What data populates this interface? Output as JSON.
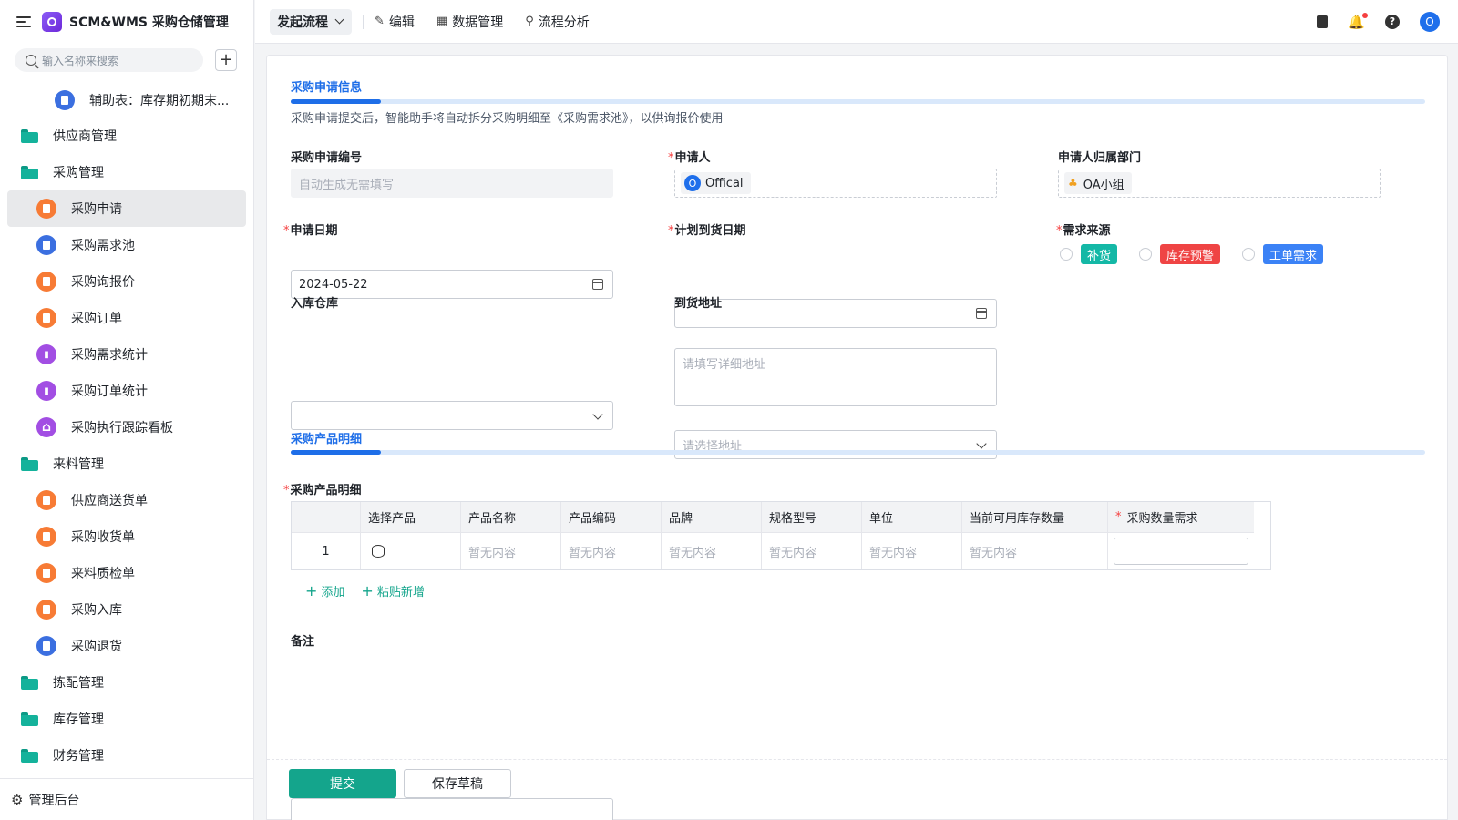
{
  "app": {
    "title": "SCM&WMS 采购仓储管理"
  },
  "search": {
    "placeholder": "输入名称来搜索"
  },
  "sidebar": {
    "pinned": {
      "label": "辅助表：库存期初期末..."
    },
    "items": [
      {
        "label": "供应商管理",
        "type": "folder"
      },
      {
        "label": "采购管理",
        "type": "folder"
      },
      {
        "label": "采购申请",
        "icon": "orange"
      },
      {
        "label": "采购需求池",
        "icon": "blue"
      },
      {
        "label": "采购询报价",
        "icon": "orange"
      },
      {
        "label": "采购订单",
        "icon": "orange"
      },
      {
        "label": "采购需求统计",
        "icon": "purple"
      },
      {
        "label": "采购订单统计",
        "icon": "purple"
      },
      {
        "label": "采购执行跟踪看板",
        "icon": "purple"
      },
      {
        "label": "来料管理",
        "type": "folder"
      },
      {
        "label": "供应商送货单",
        "icon": "orange"
      },
      {
        "label": "采购收货单",
        "icon": "orange"
      },
      {
        "label": "来料质检单",
        "icon": "orange"
      },
      {
        "label": "采购入库",
        "icon": "orange"
      },
      {
        "label": "采购退货",
        "icon": "blue"
      },
      {
        "label": "拣配管理",
        "type": "folder"
      },
      {
        "label": "库存管理",
        "type": "folder"
      },
      {
        "label": "财务管理",
        "type": "folder"
      }
    ],
    "footer": "管理后台"
  },
  "toolbar": {
    "start_flow": "发起流程",
    "edit": "编辑",
    "data_manage": "数据管理",
    "flow_analysis": "流程分析",
    "user_initial": "O"
  },
  "form": {
    "section1": {
      "title": "采购申请信息",
      "desc": "采购申请提交后，智能助手将自动拆分采购明细至《采购需求池》，以供询报价使用"
    },
    "req_no": {
      "label": "采购申请编号",
      "placeholder": "自动生成无需填写"
    },
    "applicant": {
      "label": "申请人",
      "value": "Offical",
      "initial": "O"
    },
    "dept": {
      "label": "申请人归属部门",
      "value": "OA小组"
    },
    "apply_date": {
      "label": "申请日期",
      "value": "2024-05-22"
    },
    "plan_date": {
      "label": "计划到货日期",
      "value": ""
    },
    "source": {
      "label": "需求来源",
      "options": [
        {
          "label": "补货",
          "color": "#14b8a6"
        },
        {
          "label": "库存预警",
          "color": "#ef4444"
        },
        {
          "label": "工单需求",
          "color": "#3b82f6"
        }
      ]
    },
    "warehouse": {
      "label": "入库仓库",
      "value": ""
    },
    "address": {
      "label": "到货地址",
      "placeholder": "请选择地址",
      "detail_placeholder": "请填写详细地址"
    },
    "section2": {
      "title": "采购产品明细"
    },
    "detail": {
      "label": "采购产品明细",
      "columns": [
        "",
        "选择产品",
        "产品名称",
        "产品编码",
        "品牌",
        "规格型号",
        "单位",
        "当前可用库存数量",
        "采购数量需求"
      ],
      "rows": [
        {
          "index": "1",
          "cells": [
            "暂无内容",
            "暂无内容",
            "暂无内容",
            "暂无内容",
            "暂无内容",
            "暂无内容"
          ]
        }
      ],
      "add": "添加",
      "paste_add": "粘贴新增"
    },
    "remark": {
      "label": "备注"
    }
  },
  "actions": {
    "submit": "提交",
    "save_draft": "保存草稿"
  }
}
